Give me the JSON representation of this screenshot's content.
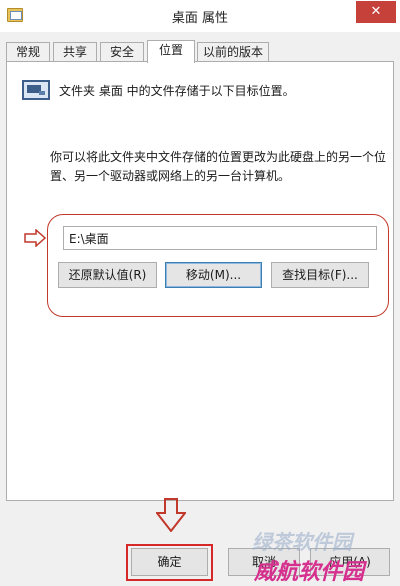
{
  "window": {
    "title": "桌面 属性",
    "close_glyph": "✕",
    "accent": "#c7413b"
  },
  "tabs": [
    {
      "label": "常规",
      "active": false
    },
    {
      "label": "共享",
      "active": false
    },
    {
      "label": "安全",
      "active": false
    },
    {
      "label": "位置",
      "active": true
    },
    {
      "label": "以前的版本",
      "active": false
    }
  ],
  "panel": {
    "description": "文件夹 桌面 中的文件存储于以下目标位置。",
    "explanation": "你可以将此文件夹中文件存储的位置更改为此硬盘上的另一个位置、另一个驱动器或网络上的另一台计算机。",
    "path_value": "E:\\桌面",
    "restore_label": "还原默认值(R)",
    "move_label": "移动(M)...",
    "find_label": "查找目标(F)..."
  },
  "footer": {
    "ok_label": "确定",
    "cancel_label": "取消",
    "apply_label": "应用(A)"
  },
  "annotation": {
    "highlight_color": "#c0392b"
  },
  "watermark": {
    "line1": "绿茶软件园",
    "line2": "威航软件园"
  }
}
